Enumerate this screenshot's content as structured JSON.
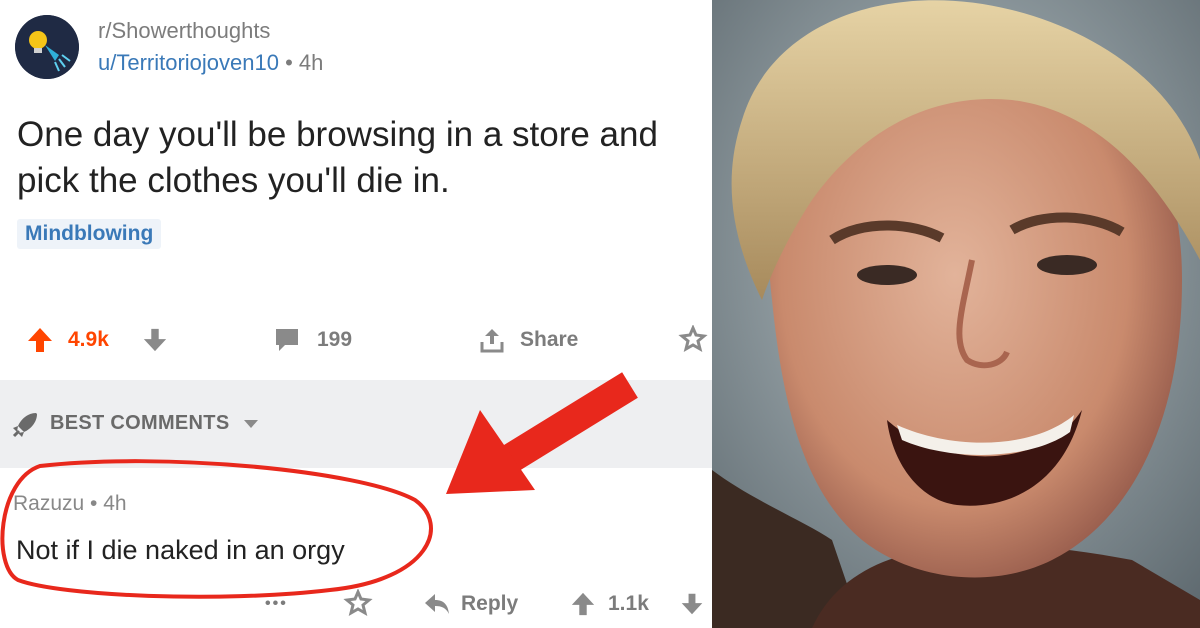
{
  "post": {
    "subreddit": "r/Showerthoughts",
    "username": "u/Territoriojoven10",
    "separator": " • ",
    "age": "4h",
    "title": "One day you'll be browsing in a store and pick the clothes you'll die in.",
    "flair": "Mindblowing",
    "upvotes": "4.9k",
    "comments": "199",
    "share_label": "Share"
  },
  "comments_section": {
    "sort_label": "BEST COMMENTS"
  },
  "comment": {
    "author": "Razuzu",
    "separator": " • ",
    "age": "4h",
    "body": "Not if I die naked in an orgy",
    "more": "•••",
    "reply_label": "Reply",
    "votes": "1.1k"
  },
  "colors": {
    "upvote": "#ff4500",
    "meta_gray": "#7c7c7c",
    "link_blue": "#3a79b8",
    "annotation_red": "#e8281c",
    "band_gray": "#eeeff1"
  },
  "icons": [
    "subreddit-icon",
    "upvote-icon",
    "downvote-icon",
    "comment-icon",
    "share-icon",
    "award-icon",
    "rocket-icon",
    "caret-down-icon",
    "reply-icon"
  ]
}
